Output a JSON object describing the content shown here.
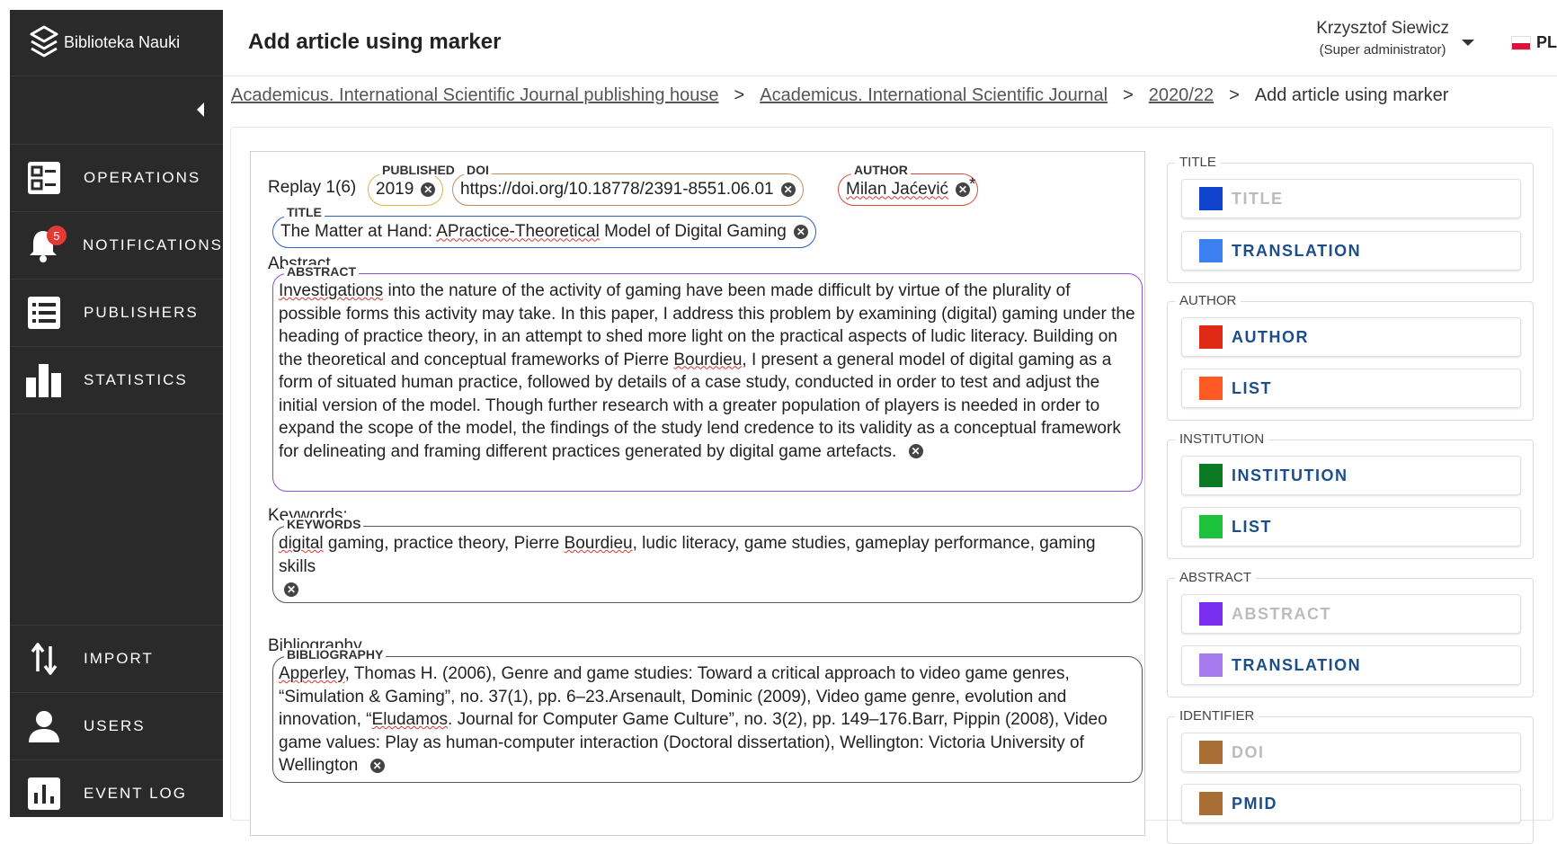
{
  "app": {
    "brand": "Biblioteka Nauki"
  },
  "header": {
    "title": "Add article using marker",
    "user_name": "Krzysztof Siewicz",
    "user_role": "(Super administrator)",
    "language": "PL"
  },
  "sidebar": {
    "items": [
      {
        "label": "OPERATIONS",
        "icon": "operations-icon"
      },
      {
        "label": "NOTIFICATIONS",
        "icon": "bell-icon",
        "badge": "5"
      },
      {
        "label": "PUBLISHERS",
        "icon": "list-icon"
      },
      {
        "label": "STATISTICS",
        "icon": "bar-chart-icon"
      }
    ],
    "bottom_items": [
      {
        "label": "IMPORT",
        "icon": "import-arrows-icon"
      },
      {
        "label": "USERS",
        "icon": "user-icon"
      },
      {
        "label": "EVENT LOG",
        "icon": "event-log-icon"
      }
    ]
  },
  "breadcrumb": {
    "items": [
      "Academicus. International Scientific Journal publishing house",
      "Academicus. International Scientific Journal",
      "2020/22"
    ],
    "current": "Add article using marker",
    "separator": ">"
  },
  "editor": {
    "replay": "Replay 1(6)",
    "published_label": "PUBLISHED",
    "published_value": "2019",
    "doi_label": "DOI",
    "doi_value": "https://doi.org/10.18778/2391-8551.06.01",
    "author_label": "AUTHOR",
    "author_value": "Milan Jaćević",
    "asterisk": "*",
    "title_label": "TITLE",
    "title_pre": "The Matter at Hand: ",
    "title_wavy": "APractice-Theoretical",
    "title_post": " Model of Digital Gaming",
    "abstract_heading": "Abstract",
    "abstract_label": "ABSTRACT",
    "abstract_w1": "Investigations",
    "abstract_t1": " into the nature of the activity of gaming have been made difficult by virtue of the plurality of possible forms this activity may take. In this paper, I address this problem by examining (digital) gaming under the heading of practice theory, in an attempt to shed more light on the practical aspects of ludic literacy. Building on the theoretical and conceptual frameworks of Pierre ",
    "abstract_w2": "Bourdieu",
    "abstract_t2": ", I present a general model of digital gaming as a form of situated human practice, followed by details of a case study, conducted in order to test and adjust the initial version of the model. Though further research with a greater population of players is needed in order to expand the scope of the model, the findings of the study lend credence to its validity as a conceptual framework for delineating and framing different practices generated by digital game artefacts.",
    "keywords_heading": "Keywords:",
    "keywords_label": "KEYWORDS",
    "keywords_w1": "digital",
    "keywords_t1": " gaming, practice theory, Pierre ",
    "keywords_w2": "Bourdieu",
    "keywords_t2": ", ludic literacy, game studies, gameplay performance, gaming skills",
    "bibliography_heading": "Bibliography",
    "bibliography_label": "BIBLIOGRAPHY",
    "bib_w1": "Apperley",
    "bib_t1": ", Thomas H. (2006), Genre and game studies: Toward a critical approach to video game genres, “Simulation & Gaming”, no. 37(1), pp. 6–23.Arsenault, Dominic (2009), Video game genre, evolution and innovation, “",
    "bib_w2": "Eludamos",
    "bib_t2": ". Journal for Computer Game Culture”, no. 3(2), pp. 149–176.Barr, Pippin (2008), Video game values: Play as human-computer interaction (Doctoral dissertation), Wellington: Victoria University of Wellington"
  },
  "markers": {
    "groups": [
      {
        "title": "TITLE",
        "buttons": [
          {
            "label": "TITLE",
            "color": "#1144cc",
            "disabled": true
          },
          {
            "label": "TRANSLATION",
            "color": "#3b7ff0",
            "disabled": false
          }
        ]
      },
      {
        "title": "AUTHOR",
        "buttons": [
          {
            "label": "AUTHOR",
            "color": "#e02a16",
            "disabled": false
          },
          {
            "label": "LIST",
            "color": "#ff5a26",
            "disabled": false
          }
        ]
      },
      {
        "title": "INSTITUTION",
        "buttons": [
          {
            "label": "INSTITUTION",
            "color": "#0b7a22",
            "disabled": false
          },
          {
            "label": "LIST",
            "color": "#1cc23c",
            "disabled": false
          }
        ]
      },
      {
        "title": "ABSTRACT",
        "buttons": [
          {
            "label": "ABSTRACT",
            "color": "#7a2ef0",
            "disabled": true
          },
          {
            "label": "TRANSLATION",
            "color": "#a87af0",
            "disabled": false
          }
        ]
      },
      {
        "title": "IDENTIFIER",
        "buttons": [
          {
            "label": "DOI",
            "color": "#a86e35",
            "disabled": true
          },
          {
            "label": "PMID",
            "color": "#a86e35",
            "disabled": false
          }
        ]
      }
    ]
  },
  "colors": {
    "sidebar_bg": "#2a2a2a",
    "published_border": "#d9b84a",
    "doi_border": "#c98a5a",
    "author_border": "#e0483c",
    "title_border": "#2f5fc0",
    "abstract_border": "#8a52d8",
    "keywords_border": "#555555",
    "bibliography_border": "#555555",
    "marker_label": "#1c4f8a"
  }
}
